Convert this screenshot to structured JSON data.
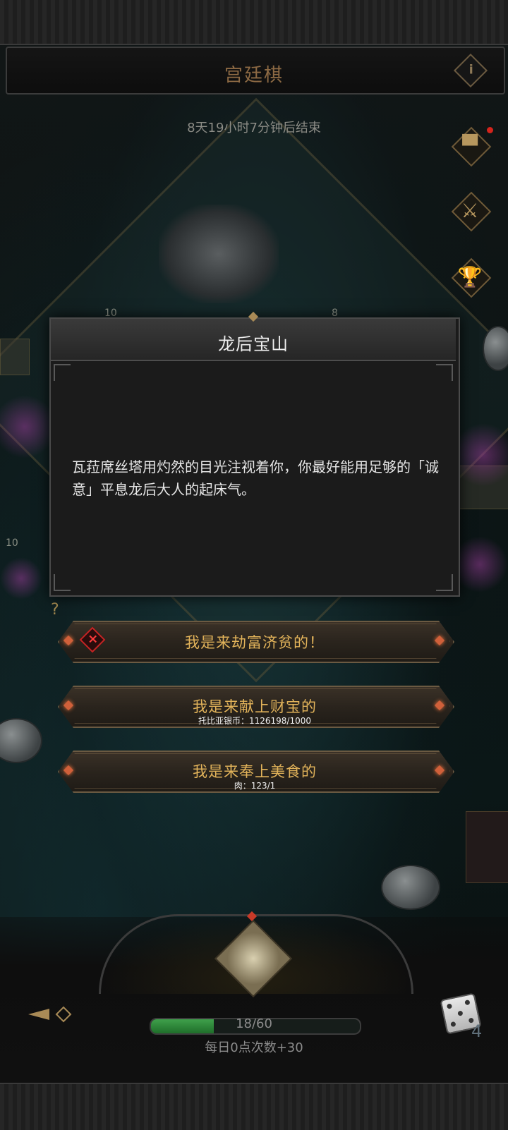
{
  "header": {
    "title": "宫廷棋",
    "info_icon": "i",
    "countdown": "8天19小时7分钟后结束"
  },
  "side_buttons": [
    {
      "name": "banner",
      "icon": "banner-icon",
      "glyph": "▀",
      "has_notification": true
    },
    {
      "name": "swords",
      "icon": "swords-icon",
      "glyph": "⚔"
    },
    {
      "name": "trophy",
      "icon": "trophy-icon",
      "glyph": "🏆"
    }
  ],
  "board": {
    "tile_numbers": [
      "10",
      "8",
      "10"
    ]
  },
  "dialog": {
    "title": "龙后宝山",
    "body": "瓦菈席丝塔用灼然的目光注视着你，你最好能用足够的「诚意」平息龙后大人的起床气。"
  },
  "choices": [
    {
      "label": "我是来劫富济贫的！",
      "sub": "",
      "disabled_icon": "×"
    },
    {
      "label": "我是来献上财宝的",
      "sub": "托比亚银币：1126198/1000"
    },
    {
      "label": "我是来奉上美食的",
      "sub": "肉：123/1"
    }
  ],
  "footer": {
    "progress_text": "18/60",
    "progress_value": 18,
    "progress_max": 60,
    "daily_text": "每日0点次数+30",
    "dice_count": "4"
  },
  "colors": {
    "accent_gold": "#e2b35a",
    "progress_green": "#3fa04b",
    "alert_red": "#d4241c"
  }
}
